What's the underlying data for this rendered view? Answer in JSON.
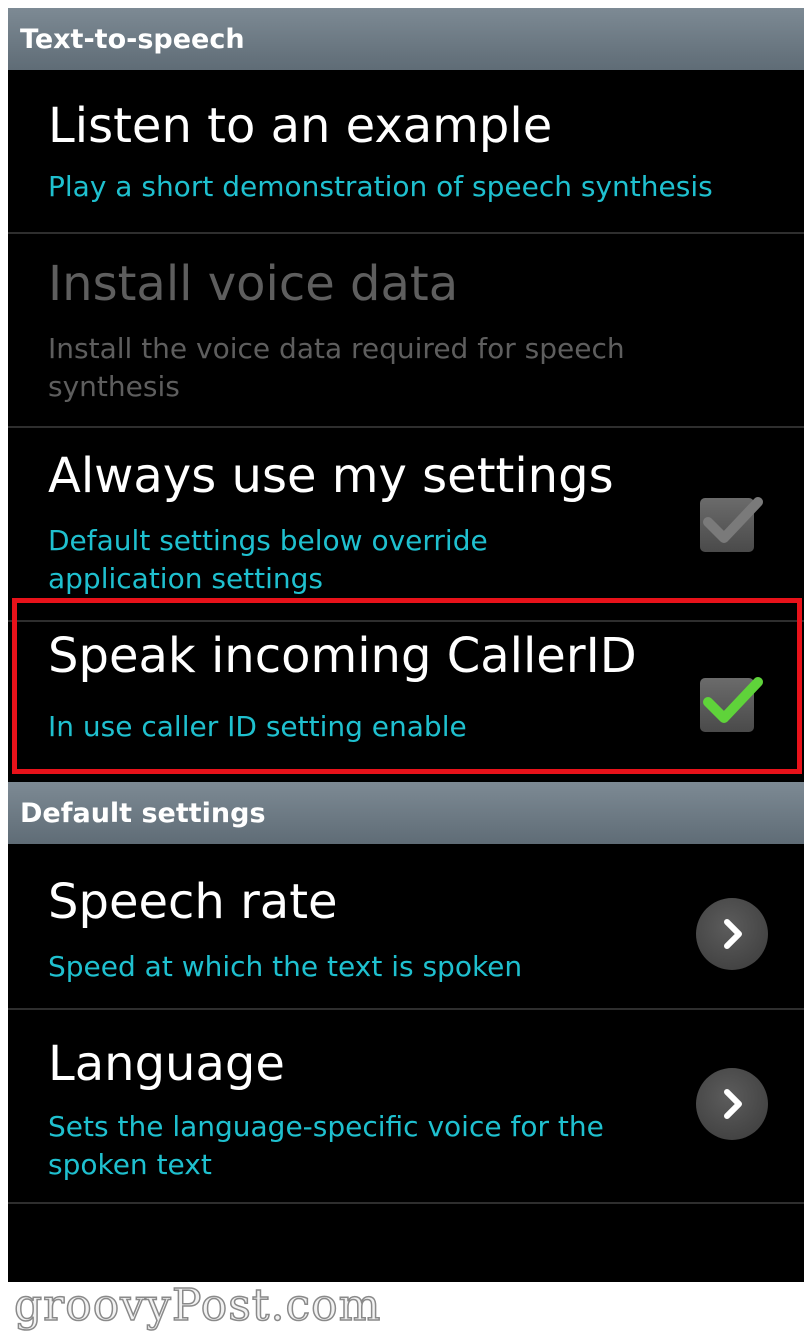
{
  "sections": {
    "tts_header": "Text-to-speech",
    "default_header": "Default settings"
  },
  "items": [
    {
      "title": "Listen to an example",
      "subtitle": "Play a short demonstration of speech synthesis"
    },
    {
      "title": "Install voice data",
      "subtitle": "Install the voice data required for speech synthesis",
      "enabled": false
    },
    {
      "title": "Always use my settings",
      "subtitle": "Default settings below override application settings",
      "checked": true,
      "enabled": false
    },
    {
      "title": "Speak incoming CallerID",
      "subtitle": "In use caller ID setting enable",
      "checked": true
    },
    {
      "title": "Speech rate",
      "subtitle": "Speed at which the text is spoken"
    },
    {
      "title": "Language",
      "subtitle": "Sets the language-specific voice for the spoken text"
    }
  ],
  "watermark": "groovyPost.com",
  "colors": {
    "background": "#000000",
    "accent_text": "#1fc0cf",
    "highlight_border": "#e8121a",
    "check_green": "#5fd33a"
  },
  "icons": {
    "checkbox": "checkbox-icon",
    "chevron": "chevron-right-icon"
  }
}
